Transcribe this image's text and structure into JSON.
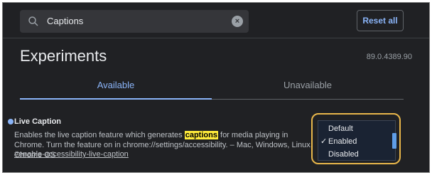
{
  "search": {
    "value": "Captions",
    "icon": "search-icon",
    "clear_icon": "clear-icon",
    "clear_glyph": "×"
  },
  "reset_label": "Reset all",
  "page": {
    "title": "Experiments",
    "version": "89.0.4389.90"
  },
  "tabs": [
    {
      "label": "Available",
      "active": true
    },
    {
      "label": "Unavailable",
      "active": false
    }
  ],
  "experiment": {
    "title": "Live Caption",
    "desc_before": "Enables the live caption feature which generates ",
    "desc_highlight": "captions",
    "desc_after": " for media playing in Chrome. Turn the feature on in chrome://settings/accessibility. – Mac, Windows, Linux, Chrome OS",
    "link": "#enable-accessibility-live-caption"
  },
  "dropdown": {
    "options": [
      {
        "label": "Default",
        "selected": false
      },
      {
        "label": "Enabled",
        "selected": true
      },
      {
        "label": "Disabled",
        "selected": false
      }
    ],
    "check_glyph": "✓"
  },
  "colors": {
    "background": "#202124",
    "accent": "#8ab4f8",
    "highlight": "#ffeb3b",
    "annotation": "#e8b64a"
  }
}
